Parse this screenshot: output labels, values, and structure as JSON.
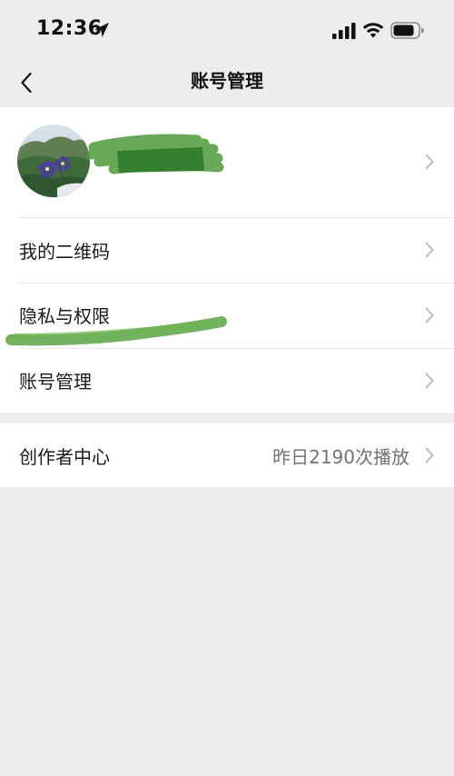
{
  "status_bar": {
    "time": "12:36"
  },
  "nav": {
    "title": "账号管理"
  },
  "menu": {
    "my_qr_code": "我的二维码",
    "privacy": "隐私与权限",
    "account_management": "账号管理",
    "creator_center": "创作者中心",
    "creator_center_stat": "昨日2190次播放"
  }
}
